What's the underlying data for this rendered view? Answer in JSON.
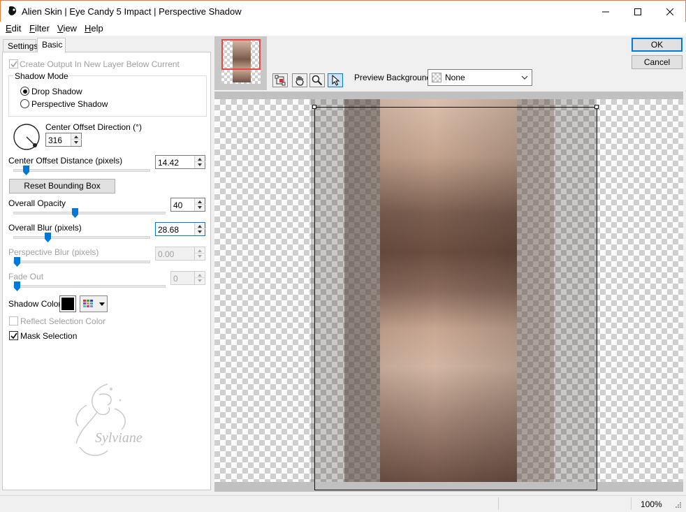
{
  "window": {
    "title": "Alien Skin | Eye Candy 5 Impact | Perspective Shadow",
    "controls": [
      "minimize",
      "maximize",
      "close"
    ]
  },
  "menu": [
    {
      "label": "Edit",
      "mnemonic": "E",
      "rest": "dit"
    },
    {
      "label": "Filter",
      "mnemonic": "F",
      "rest": "ilter"
    },
    {
      "label": "View",
      "mnemonic": "V",
      "rest": "iew"
    },
    {
      "label": "Help",
      "mnemonic": "H",
      "rest": "elp"
    }
  ],
  "tabs": {
    "settings": "Settings",
    "basic": "Basic",
    "active": "Basic"
  },
  "basic": {
    "create_output_label": "Create Output In New Layer Below Current",
    "create_output_checked": true,
    "create_output_enabled": false,
    "shadow_mode": {
      "title": "Shadow Mode",
      "options": [
        "Drop Shadow",
        "Perspective Shadow"
      ],
      "selected": "Drop Shadow"
    },
    "center_offset_direction": {
      "label": "Center Offset Direction (°)",
      "value": "316"
    },
    "center_offset_distance": {
      "label": "Center Offset Distance (pixels)",
      "value": "14.42",
      "level": 0.07
    },
    "reset_bounding_box": "Reset Bounding Box",
    "overall_opacity": {
      "label": "Overall Opacity",
      "value": "40",
      "level": 0.4
    },
    "overall_blur": {
      "label": "Overall Blur (pixels)",
      "value": "28.68",
      "level": 0.24
    },
    "perspective_blur": {
      "label": "Perspective Blur (pixels)",
      "value": "0.00",
      "level": 0.0,
      "enabled": false
    },
    "fade_out": {
      "label": "Fade Out",
      "value": "0",
      "level": 0.0,
      "enabled": false
    },
    "shadow_color": {
      "label": "Shadow Color",
      "color": "#000000"
    },
    "reflect_selection_color": {
      "label": "Reflect Selection Color",
      "checked": false,
      "enabled": false
    },
    "mask_selection": {
      "label": "Mask Selection",
      "checked": true
    }
  },
  "watermark": {
    "text": "Sylviane"
  },
  "buttons": {
    "ok": "OK",
    "cancel": "Cancel"
  },
  "toolbar": {
    "tools": [
      "bounding-box-tool",
      "hand-tool",
      "zoom-tool",
      "pointer-tool"
    ],
    "active_tool": "pointer-tool",
    "preview_background_label": "Preview Background:",
    "preview_background_value": "None"
  },
  "status": {
    "zoom": "100%"
  },
  "colors": {
    "accent": "#0078d7",
    "title_border": "#f3763b"
  }
}
